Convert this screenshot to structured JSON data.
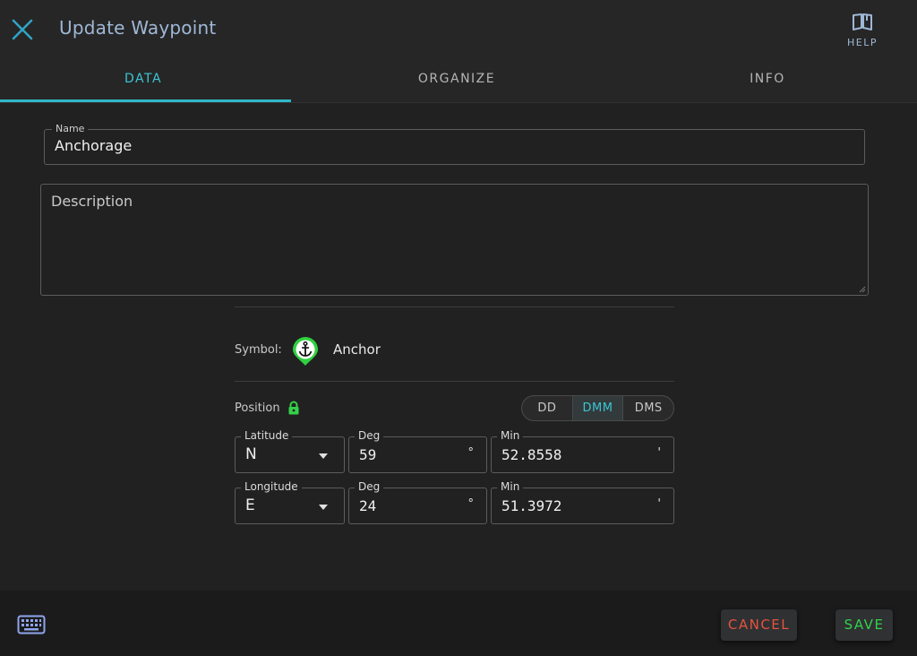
{
  "header": {
    "title": "Update Waypoint",
    "help_label": "HELP",
    "accent_color": "#2fb7c6"
  },
  "tabs": [
    {
      "label": "DATA",
      "active": true
    },
    {
      "label": "ORGANIZE",
      "active": false
    },
    {
      "label": "INFO",
      "active": false
    }
  ],
  "form": {
    "name_label": "Name",
    "name_value": "Anchorage",
    "description_placeholder": "Description",
    "symbol_label": "Symbol:",
    "symbol_name": "Anchor",
    "symbol_icon": "anchor-icon",
    "position_label": "Position",
    "position_locked": true,
    "formats": [
      {
        "label": "DD",
        "active": false
      },
      {
        "label": "DMM",
        "active": true
      },
      {
        "label": "DMS",
        "active": false
      }
    ],
    "latitude": {
      "label": "Latitude",
      "hemisphere": "N",
      "deg_label": "Deg",
      "deg": "59",
      "deg_unit": "°",
      "min_label": "Min",
      "min": "52.8558",
      "min_unit": "'"
    },
    "longitude": {
      "label": "Longitude",
      "hemisphere": "E",
      "deg_label": "Deg",
      "deg": "24",
      "deg_unit": "°",
      "min_label": "Min",
      "min": "51.3972",
      "min_unit": "'"
    }
  },
  "footer": {
    "cancel_label": "CANCEL",
    "save_label": "SAVE",
    "cancel_color": "#e5533f",
    "save_color": "#33d14a"
  }
}
